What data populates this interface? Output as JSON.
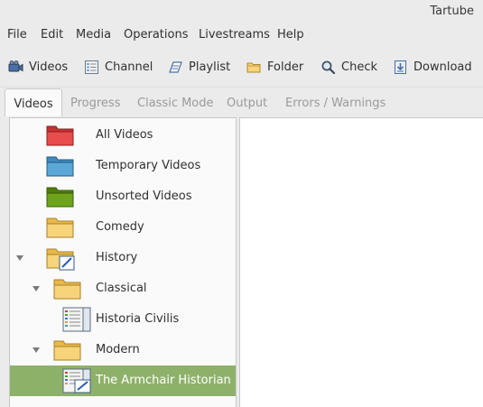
{
  "window": {
    "title": "Tartube"
  },
  "menu": [
    "File",
    "Edit",
    "Media",
    "Operations",
    "Livestreams",
    "Help"
  ],
  "toolbar": {
    "videos": "Videos",
    "channel": "Channel",
    "playlist": "Playlist",
    "folder": "Folder",
    "check": "Check",
    "download": "Download"
  },
  "tabs": [
    "Videos",
    "Progress",
    "Classic Mode",
    "Output",
    "Errors / Warnings"
  ],
  "tree": [
    {
      "label": "All Videos",
      "icon": "folder-red-icon"
    },
    {
      "label": "Temporary Videos",
      "icon": "folder-blue-icon"
    },
    {
      "label": "Unsorted Videos",
      "icon": "folder-green-icon"
    },
    {
      "label": "Comedy",
      "icon": "folder-yellow-icon"
    },
    {
      "label": "History",
      "icon": "folder-yellow-edit-icon",
      "expanded": true
    },
    {
      "label": "Classical",
      "icon": "folder-yellow-icon",
      "expanded": true
    },
    {
      "label": "Historia Civilis",
      "icon": "channel-list-icon"
    },
    {
      "label": "Modern",
      "icon": "folder-yellow-icon",
      "expanded": true
    },
    {
      "label": "The Armchair Historian",
      "icon": "channel-list-edit-icon",
      "selected": true
    }
  ],
  "colors": {
    "selection": "#8eb16a",
    "folder_red": "#e84c4c",
    "folder_blue": "#5ba8d8",
    "folder_green": "#6fa41a",
    "folder_yellow": "#f7d47a"
  }
}
